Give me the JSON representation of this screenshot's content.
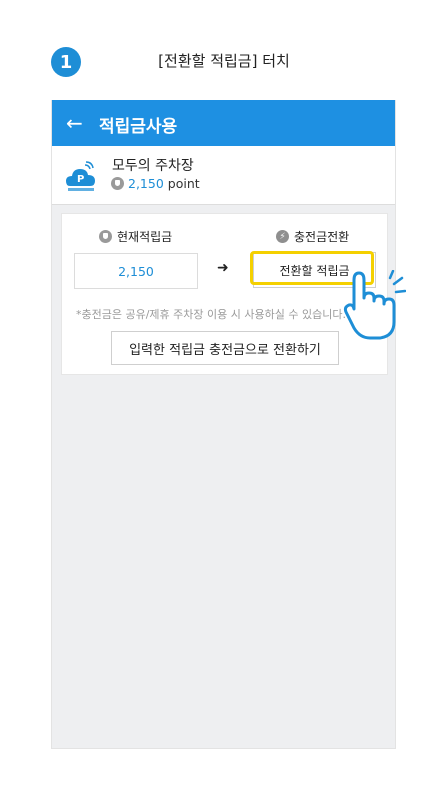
{
  "step": {
    "number": "1",
    "instruction": "[전환할 적립금] 터치"
  },
  "appbar": {
    "back_glyph": "←",
    "title": "적립금사용"
  },
  "station": {
    "name": "모두의 주차장",
    "points": "2,150",
    "point_unit": "point",
    "logo_icon": "parking-cloud-logo-icon"
  },
  "card": {
    "current_label": "현재적립금",
    "convert_label": "충전금전환",
    "current_value": "2,150",
    "arrow_glyph": "➜",
    "convert_button": "전환할 적립금",
    "note": "*충전금은 공유/제휴 주차장 이용 시 사용하실 수 있습니다.",
    "submit_button": "입력한 적립금 충전금으로 전환하기"
  },
  "colors": {
    "brand": "#1e90e2",
    "highlight": "#f4d000",
    "point_text": "#1e8ed6"
  }
}
